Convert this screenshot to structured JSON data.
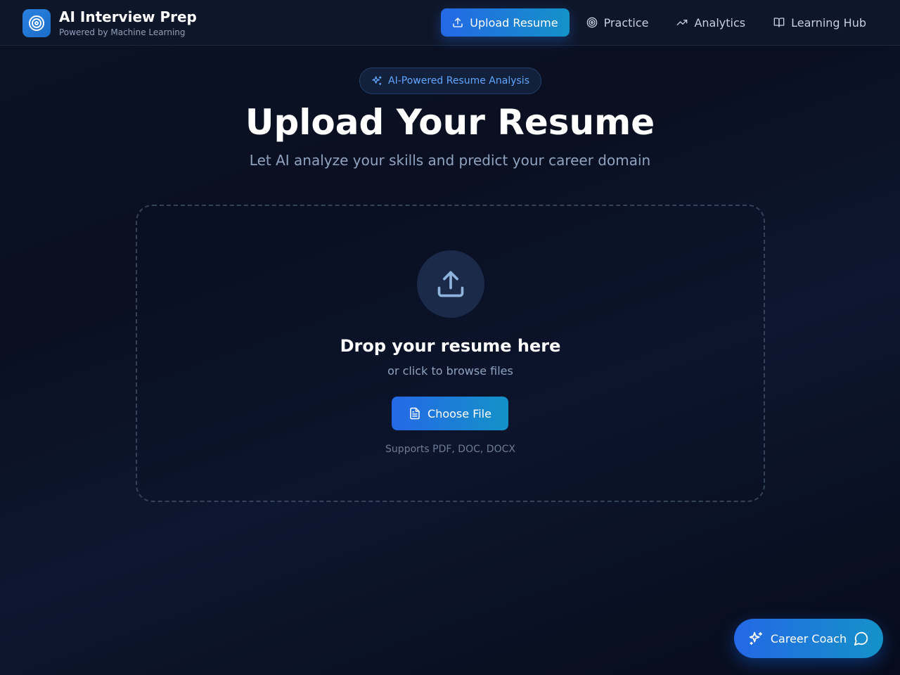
{
  "header": {
    "title": "AI Interview Prep",
    "subtitle": "Powered by Machine Learning",
    "logo_icon": "target-icon",
    "nav": [
      {
        "label": "Upload Resume",
        "icon": "upload-icon",
        "active": true
      },
      {
        "label": "Practice",
        "icon": "target-icon",
        "active": false
      },
      {
        "label": "Analytics",
        "icon": "trending-up-icon",
        "active": false
      },
      {
        "label": "Learning Hub",
        "icon": "book-open-icon",
        "active": false
      }
    ]
  },
  "hero": {
    "badge": "AI-Powered Resume Analysis",
    "badge_icon": "sparkles-icon",
    "title": "Upload Your Resume",
    "subtitle": "Let AI analyze your skills and predict your career domain"
  },
  "dropzone": {
    "icon": "upload-icon",
    "title": "Drop your resume here",
    "subtitle": "or click to browse files",
    "button_label": "Choose File",
    "button_icon": "file-text-icon",
    "supports": "Supports PDF, DOC, DOCX"
  },
  "coach": {
    "label": "Career Coach",
    "icon": "sparkles-icon",
    "trailing_icon": "message-circle-icon"
  },
  "colors": {
    "accent_start": "#2468e6",
    "accent_end": "#1492c8",
    "background": "#0b1223",
    "badge_text": "#5fa6ff"
  }
}
